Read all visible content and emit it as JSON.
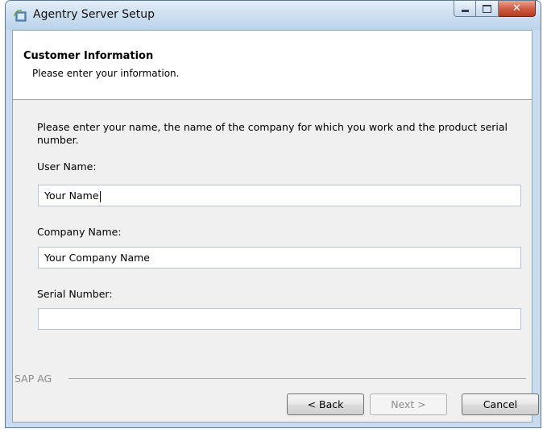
{
  "window": {
    "title": "Agentry Server Setup"
  },
  "banner": {
    "title": "Customer Information",
    "subtitle": "Please enter your information."
  },
  "instructions": "Please enter your name, the name of the company for which you work and the product serial number.",
  "fields": {
    "user_name": {
      "label": "User Name:",
      "value": "Your Name"
    },
    "company_name": {
      "label": "Company Name:",
      "value": "Your Company Name"
    },
    "serial_number": {
      "label": "Serial Number:",
      "value": ""
    }
  },
  "footer": {
    "brand": "SAP AG",
    "back_label": "< Back",
    "next_label": "Next >",
    "cancel_label": "Cancel"
  },
  "colors": {
    "titlebar": "#cfe0f1",
    "close_button": "#cf5e45",
    "dialog_background": "#f0f0f0"
  }
}
